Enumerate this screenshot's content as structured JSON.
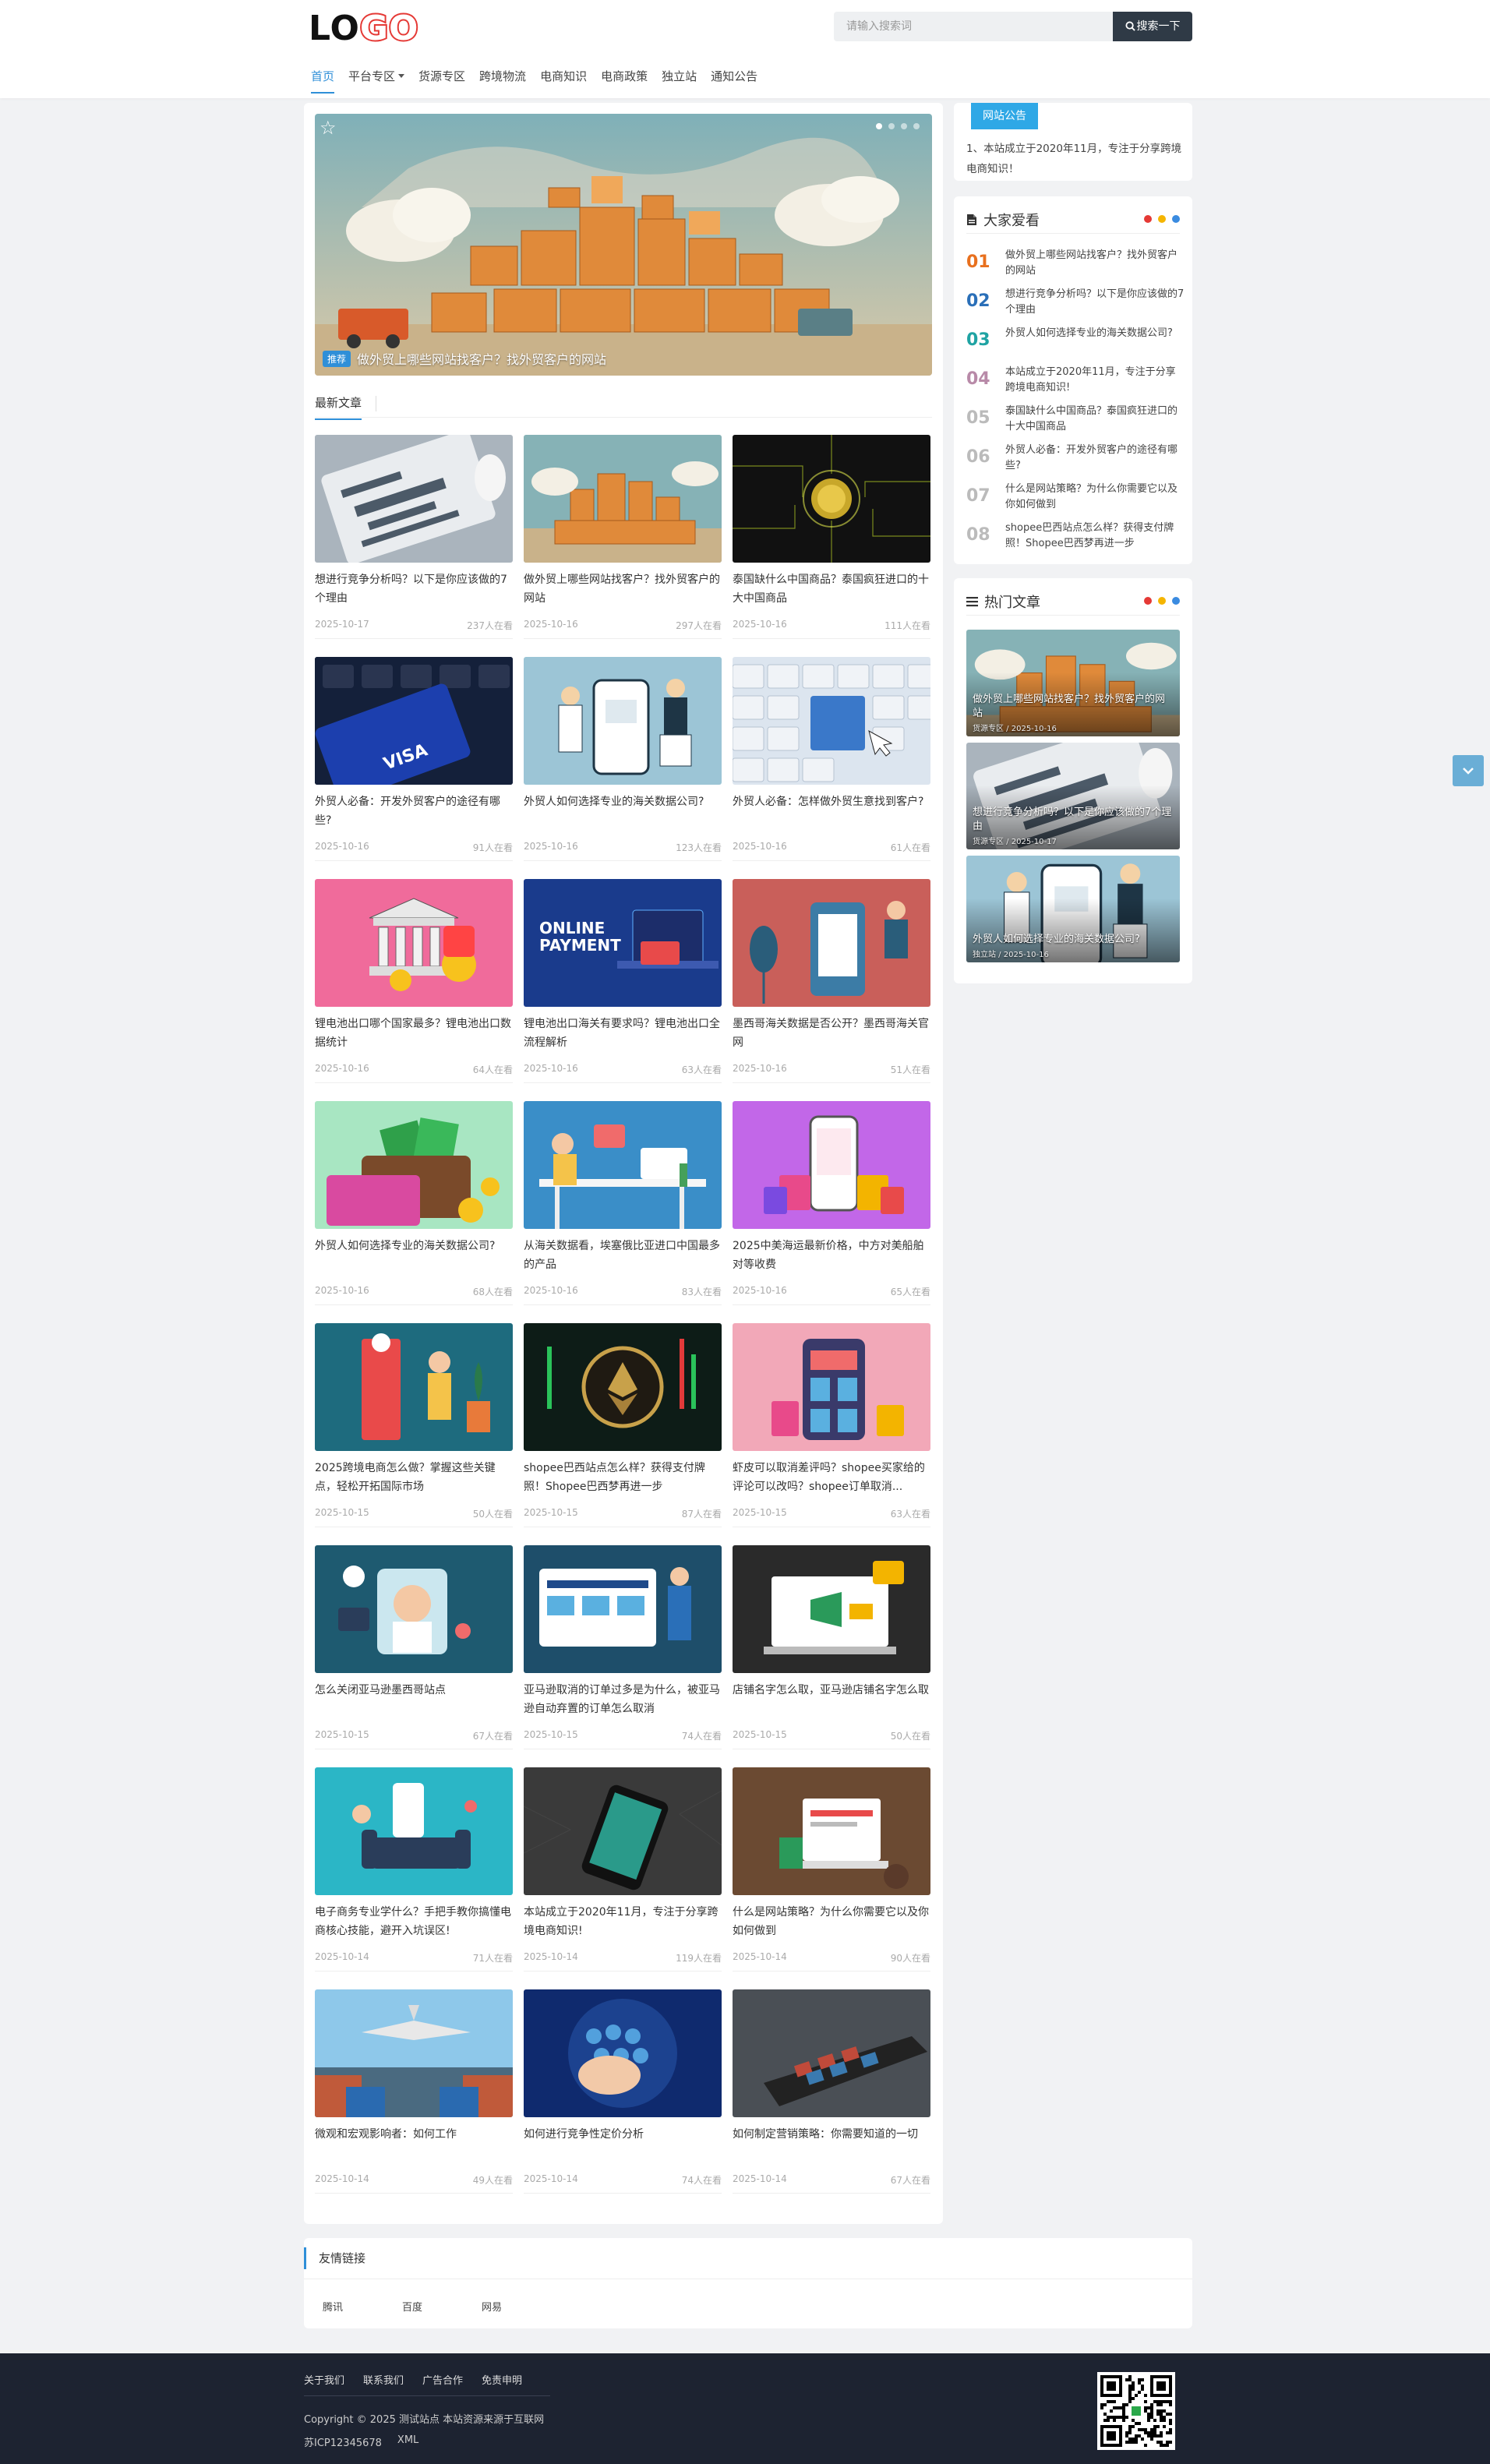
{
  "header": {
    "logo": {
      "part1": "LO",
      "part2": "GO"
    },
    "search": {
      "placeholder": "请输入搜索词",
      "button": "搜索一下"
    },
    "nav": [
      {
        "label": "首页",
        "active": true
      },
      {
        "label": "平台专区",
        "dropdown": true
      },
      {
        "label": "货源专区"
      },
      {
        "label": "跨境物流"
      },
      {
        "label": "电商知识"
      },
      {
        "label": "电商政策"
      },
      {
        "label": "独立站"
      },
      {
        "label": "通知公告"
      }
    ]
  },
  "slider": {
    "tag": "推荐",
    "caption": "做外贸上哪些网站找客户？找外贸客户的网站"
  },
  "latest_tab": "最新文章",
  "articles": [
    {
      "title": "想进行竞争分析吗？以下是你应该做的7个理由",
      "date": "2025-10-17",
      "views": "237人在看",
      "img": "cyber"
    },
    {
      "title": "做外贸上哪些网站找客户？找外贸客户的网站",
      "date": "2025-10-16",
      "views": "297人在看",
      "img": "boxes"
    },
    {
      "title": "泰国缺什么中国商品？泰国疯狂进口的十大中国商品",
      "date": "2025-10-16",
      "views": "111人在看",
      "img": "circuit"
    },
    {
      "title": "外贸人必备：开发外贸客户的途径有哪些?",
      "date": "2025-10-16",
      "views": "91人在看",
      "img": "visa"
    },
    {
      "title": "外贸人如何选择专业的海关数据公司?",
      "date": "2025-10-16",
      "views": "123人在看",
      "img": "shop"
    },
    {
      "title": "外贸人必备：怎样做外贸生意找到客户?",
      "date": "2025-10-16",
      "views": "61人在看",
      "img": "keyboard"
    },
    {
      "title": "锂电池出口哪个国家最多？锂电池出口数据统计",
      "date": "2025-10-16",
      "views": "64人在看",
      "img": "bank"
    },
    {
      "title": "锂电池出口海关有要求吗？锂电池出口全流程解析",
      "date": "2025-10-16",
      "views": "63人在看",
      "img": "payment"
    },
    {
      "title": "墨西哥海关数据是否公开？墨西哥海关官网",
      "date": "2025-10-16",
      "views": "51人在看",
      "img": "plant"
    },
    {
      "title": "外贸人如何选择专业的海关数据公司?",
      "date": "2025-10-16",
      "views": "68人在看",
      "img": "wallet"
    },
    {
      "title": "从海关数据看，埃塞俄比亚进口中国最多的产品",
      "date": "2025-10-16",
      "views": "83人在看",
      "img": "desk"
    },
    {
      "title": "2025中美海运最新价格，中方对美船舶对等收费",
      "date": "2025-10-16",
      "views": "65人在看",
      "img": "phonebags"
    },
    {
      "title": "2025跨境电商怎么做？掌握这些关键点，轻松开拓国际市场",
      "date": "2025-10-15",
      "views": "50人在看",
      "img": "clothes"
    },
    {
      "title": "shopee巴西站点怎么样？获得支付牌照！Shopee巴西梦再进一步",
      "date": "2025-10-15",
      "views": "87人在看",
      "img": "eth"
    },
    {
      "title": "虾皮可以取消差评吗？shopee买家给的评论可以改吗？shopee订单取消...",
      "date": "2025-10-15",
      "views": "63人在看",
      "img": "storefront"
    },
    {
      "title": "怎么关闭亚马逊墨西哥站点",
      "date": "2025-10-15",
      "views": "67人在看",
      "img": "support"
    },
    {
      "title": "亚马逊取消的订单过多是为什么，被亚马逊自动弃置的订单怎么取消",
      "date": "2025-10-15",
      "views": "74人在看",
      "img": "web"
    },
    {
      "title": "店铺名字怎么取，亚马逊店铺名字怎么取",
      "date": "2025-10-15",
      "views": "50人在看",
      "img": "laptop"
    },
    {
      "title": "电子商务专业学什么？手把手教你搞懂电商核心技能，避开入坑误区!",
      "date": "2025-10-14",
      "views": "71人在看",
      "img": "sofa"
    },
    {
      "title": "本站成立于2020年11月，专注于分享跨境电商知识!",
      "date": "2025-10-14",
      "views": "119人在看",
      "img": "smartphone"
    },
    {
      "title": "什么是网站策略？为什么你需要它以及你如何做到",
      "date": "2025-10-14",
      "views": "90人在看",
      "img": "brownlaptop"
    },
    {
      "title": "微观和宏观影响者：如何工作",
      "date": "2025-10-14",
      "views": "49人在看",
      "img": "plane"
    },
    {
      "title": "如何进行竞争性定价分析",
      "date": "2025-10-14",
      "views": "74人在看",
      "img": "hand"
    },
    {
      "title": "如何制定营销策略：你需要知道的一切",
      "date": "2025-10-14",
      "views": "67人在看",
      "img": "ship"
    }
  ],
  "notice": {
    "tag": "网站公告",
    "text": "1、本站成立于2020年11月，专注于分享跨境电商知识！"
  },
  "love": {
    "title": "大家爱看",
    "items": [
      {
        "num": "01",
        "title": "做外贸上哪些网站找客户？找外贸客户的网站",
        "color": "#e8701e"
      },
      {
        "num": "02",
        "title": "想进行竞争分析吗？以下是你应该做的7个理由",
        "color": "#2a6fb8"
      },
      {
        "num": "03",
        "title": "外贸人如何选择专业的海关数据公司?",
        "color": "#1fa3a3"
      },
      {
        "num": "04",
        "title": "本站成立于2020年11月，专注于分享跨境电商知识!",
        "color": "#b88aa8"
      },
      {
        "num": "05",
        "title": "泰国缺什么中国商品？泰国疯狂进口的十大中国商品",
        "color": "#bbbbbb"
      },
      {
        "num": "06",
        "title": "外贸人必备：开发外贸客户的途径有哪些?",
        "color": "#bbbbbb"
      },
      {
        "num": "07",
        "title": "什么是网站策略？为什么你需要它以及你如何做到",
        "color": "#bbbbbb"
      },
      {
        "num": "08",
        "title": "shopee巴西站点怎么样？获得支付牌照！Shopee巴西梦再进一步",
        "color": "#bbbbbb"
      }
    ]
  },
  "hot": {
    "title": "热门文章",
    "items": [
      {
        "title": "做外贸上哪些网站找客户？找外贸客户的网站",
        "meta": "货源专区 / 2025-10-16",
        "img": "boxes"
      },
      {
        "title": "想进行竞争分析吗？以下是你应该做的7个理由",
        "meta": "货源专区 / 2025-10-17",
        "img": "cyber"
      },
      {
        "title": "外贸人如何选择专业的海关数据公司?",
        "meta": "独立站 / 2025-10-16",
        "img": "shop"
      }
    ]
  },
  "dots_colors": [
    "#e53935",
    "#f5b500",
    "#3a8be0"
  ],
  "links": {
    "title": "友情链接",
    "items": [
      "腾讯",
      "百度",
      "网易"
    ]
  },
  "footer": {
    "links": [
      "关于我们",
      "联系我们",
      "广告合作",
      "免责申明"
    ],
    "copyright": "Copyright © 2025 测试站点 本站资源来源于互联网",
    "icp": "苏ICP12345678",
    "xml": "XML"
  }
}
